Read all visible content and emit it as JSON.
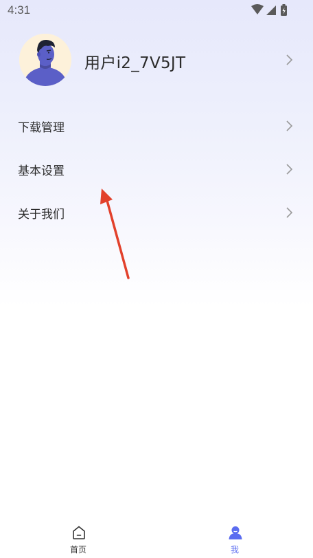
{
  "status_bar": {
    "time": "4:31",
    "icons": [
      "wifi-icon",
      "cellular-signal-icon",
      "battery-charging-icon"
    ]
  },
  "profile": {
    "username": "用户i2_7V5JT",
    "avatar": "avatar"
  },
  "menu": {
    "items": [
      {
        "label": "下载管理",
        "icon": "chevron-right-icon"
      },
      {
        "label": "基本设置",
        "icon": "chevron-right-icon"
      },
      {
        "label": "关于我们",
        "icon": "chevron-right-icon"
      }
    ]
  },
  "tab_bar": {
    "tabs": [
      {
        "label": "首页",
        "icon": "home-icon",
        "active": false
      },
      {
        "label": "我",
        "icon": "person-icon",
        "active": true
      }
    ]
  },
  "colors": {
    "accent": "#5b6cf0",
    "annotation_arrow": "#e2412c",
    "text": "#2b2b2b",
    "chevron": "#9a9a9a"
  }
}
